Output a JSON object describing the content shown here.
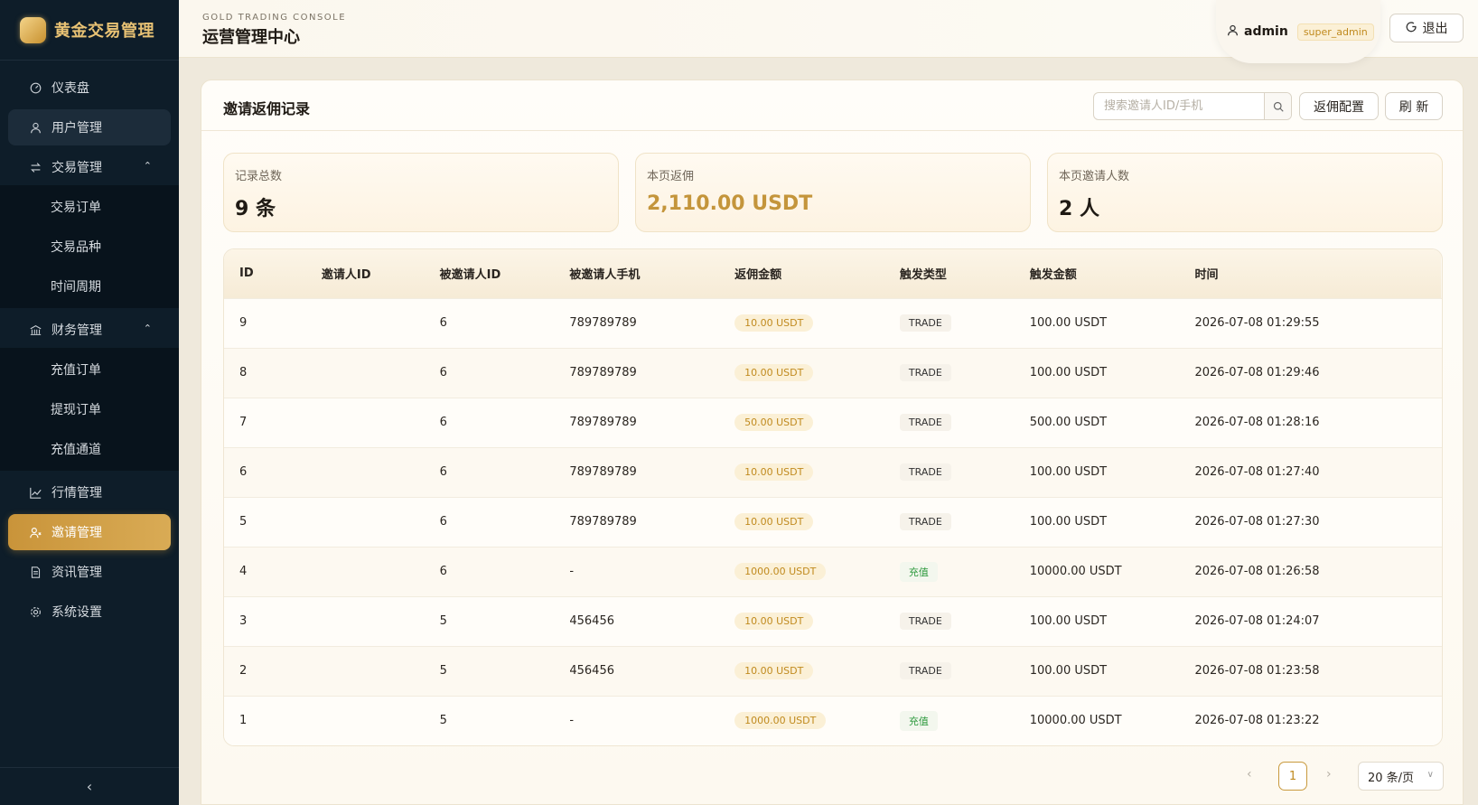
{
  "brand": {
    "title": "黄金交易管理"
  },
  "sidebar": {
    "items": [
      {
        "label": "仪表盘",
        "icon": "dashboard-icon"
      },
      {
        "label": "用户管理",
        "icon": "user-icon"
      }
    ],
    "groups": [
      {
        "label": "交易管理",
        "icon": "swap-icon",
        "expanded": true,
        "children": [
          "交易订单",
          "交易品种",
          "时间周期"
        ]
      },
      {
        "label": "财务管理",
        "icon": "bank-icon",
        "expanded": true,
        "children": [
          "充值订单",
          "提现订单",
          "充值通道"
        ]
      }
    ],
    "bottom_items": [
      {
        "label": "行情管理",
        "icon": "chart-icon"
      },
      {
        "label": "邀请管理",
        "icon": "invite-icon",
        "active": true
      },
      {
        "label": "资讯管理",
        "icon": "document-icon"
      },
      {
        "label": "系统设置",
        "icon": "gear-icon"
      }
    ]
  },
  "header": {
    "subtitle": "GOLD TRADING CONSOLE",
    "title": "运营管理中心",
    "user": "admin",
    "role": "super_admin",
    "logout": "退出"
  },
  "card": {
    "title": "邀请返佣记录",
    "search_placeholder": "搜索邀请人ID/手机",
    "config_btn": "返佣配置",
    "refresh_btn": "刷 新"
  },
  "stats": [
    {
      "label": "记录总数",
      "value": "9 条"
    },
    {
      "label": "本页返佣",
      "value": "2,110.00 USDT"
    },
    {
      "label": "本页邀请人数",
      "value": "2 人"
    }
  ],
  "table": {
    "columns": [
      "ID",
      "邀请人ID",
      "被邀请人ID",
      "被邀请人手机",
      "返佣金额",
      "触发类型",
      "触发金额",
      "时间"
    ],
    "rows": [
      [
        "9",
        "",
        "6",
        "789789789",
        "10.00 USDT",
        "TRADE",
        "100.00 USDT",
        "2026-07-08 01:29:55"
      ],
      [
        "8",
        "",
        "6",
        "789789789",
        "10.00 USDT",
        "TRADE",
        "100.00 USDT",
        "2026-07-08 01:29:46"
      ],
      [
        "7",
        "",
        "6",
        "789789789",
        "50.00 USDT",
        "TRADE",
        "500.00 USDT",
        "2026-07-08 01:28:16"
      ],
      [
        "6",
        "",
        "6",
        "789789789",
        "10.00 USDT",
        "TRADE",
        "100.00 USDT",
        "2026-07-08 01:27:40"
      ],
      [
        "5",
        "",
        "6",
        "789789789",
        "10.00 USDT",
        "TRADE",
        "100.00 USDT",
        "2026-07-08 01:27:30"
      ],
      [
        "4",
        "",
        "6",
        "-",
        "1000.00 USDT",
        "充值",
        "10000.00 USDT",
        "2026-07-08 01:26:58"
      ],
      [
        "3",
        "",
        "5",
        "456456",
        "10.00 USDT",
        "TRADE",
        "100.00 USDT",
        "2026-07-08 01:24:07"
      ],
      [
        "2",
        "",
        "5",
        "456456",
        "10.00 USDT",
        "TRADE",
        "100.00 USDT",
        "2026-07-08 01:23:58"
      ],
      [
        "1",
        "",
        "5",
        "-",
        "1000.00 USDT",
        "充值",
        "10000.00 USDT",
        "2026-07-08 01:23:22"
      ]
    ]
  },
  "pager": {
    "current": "1",
    "page_size": "20 条/页"
  },
  "colors": {
    "accent": "#c9943a",
    "sidebar_bg": "#0e1d29",
    "recharge_green": "#2e9a3e"
  }
}
